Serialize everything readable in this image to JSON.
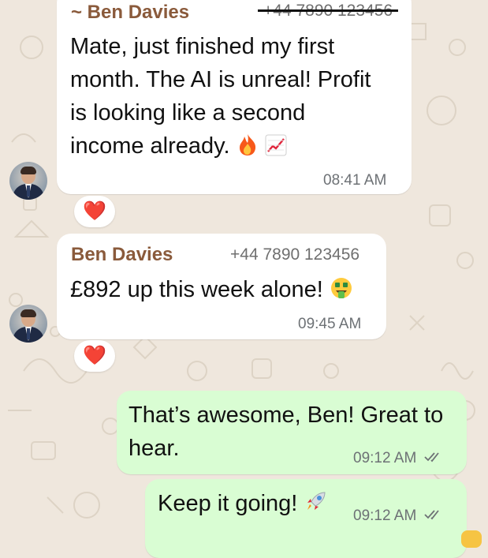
{
  "chat": {
    "messages": [
      {
        "sender": "~ Ben Davies",
        "phone": "+44 7890 123456",
        "lines": [
          "Mate, just finished my first",
          "month. The AI is unreal! Profit",
          "is looking like a second",
          "income already."
        ],
        "emoji": [
          "fire",
          "chart-increasing"
        ],
        "time": "08:41 AM",
        "reaction": "❤️"
      },
      {
        "sender": "Ben Davies",
        "phone": "+44 7890 123456",
        "text": "£892 up this week alone!",
        "emoji": [
          "money-mouth-face"
        ],
        "time": "09:45 AM",
        "reaction": "❤️"
      },
      {
        "lines": [
          "That’s awesome, Ben! Great to",
          "hear."
        ],
        "time": "09:12 AM",
        "outgoing": true
      },
      {
        "text": "Keep it going!",
        "emoji": [
          "rocket"
        ],
        "time": "09:12 AM",
        "outgoing": true
      }
    ]
  },
  "colors": {
    "incoming_bubble": "#ffffff",
    "outgoing_bubble": "#d9fdd3",
    "sender_name": "#8a5a3b",
    "wallpaper": "#efe7dd",
    "reaction_heart": "#e0243a"
  }
}
